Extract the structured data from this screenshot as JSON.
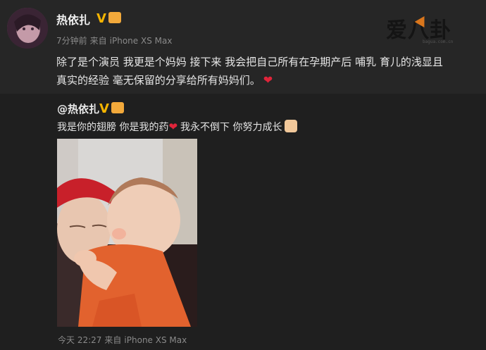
{
  "post": {
    "username": "热依扎",
    "verified_icon": "V",
    "time": "7分钟前",
    "source_prefix": "来自",
    "device": "iPhone XS Max",
    "text": "除了是个演员 我更是个妈妈 接下来 我会把自己所有在孕期产后 哺乳 育儿的浅显且真实的经验 毫无保留的分享给所有妈妈们。",
    "emoji": "heart-icon"
  },
  "watermark": {
    "text": "爱八卦",
    "sub": "bagua.com.cn"
  },
  "repost": {
    "username": "@热依扎",
    "text_part1": "我是你的翅膀 你是我的药",
    "text_part2": "我永不倒下 你努力成长",
    "time": "今天 22:27",
    "source_prefix": "来自",
    "device": "iPhone XS Max"
  },
  "colors": {
    "background": "#1f1f1f",
    "top_panel": "#262626",
    "verified": "#f4b400",
    "heart": "#e0243a"
  }
}
